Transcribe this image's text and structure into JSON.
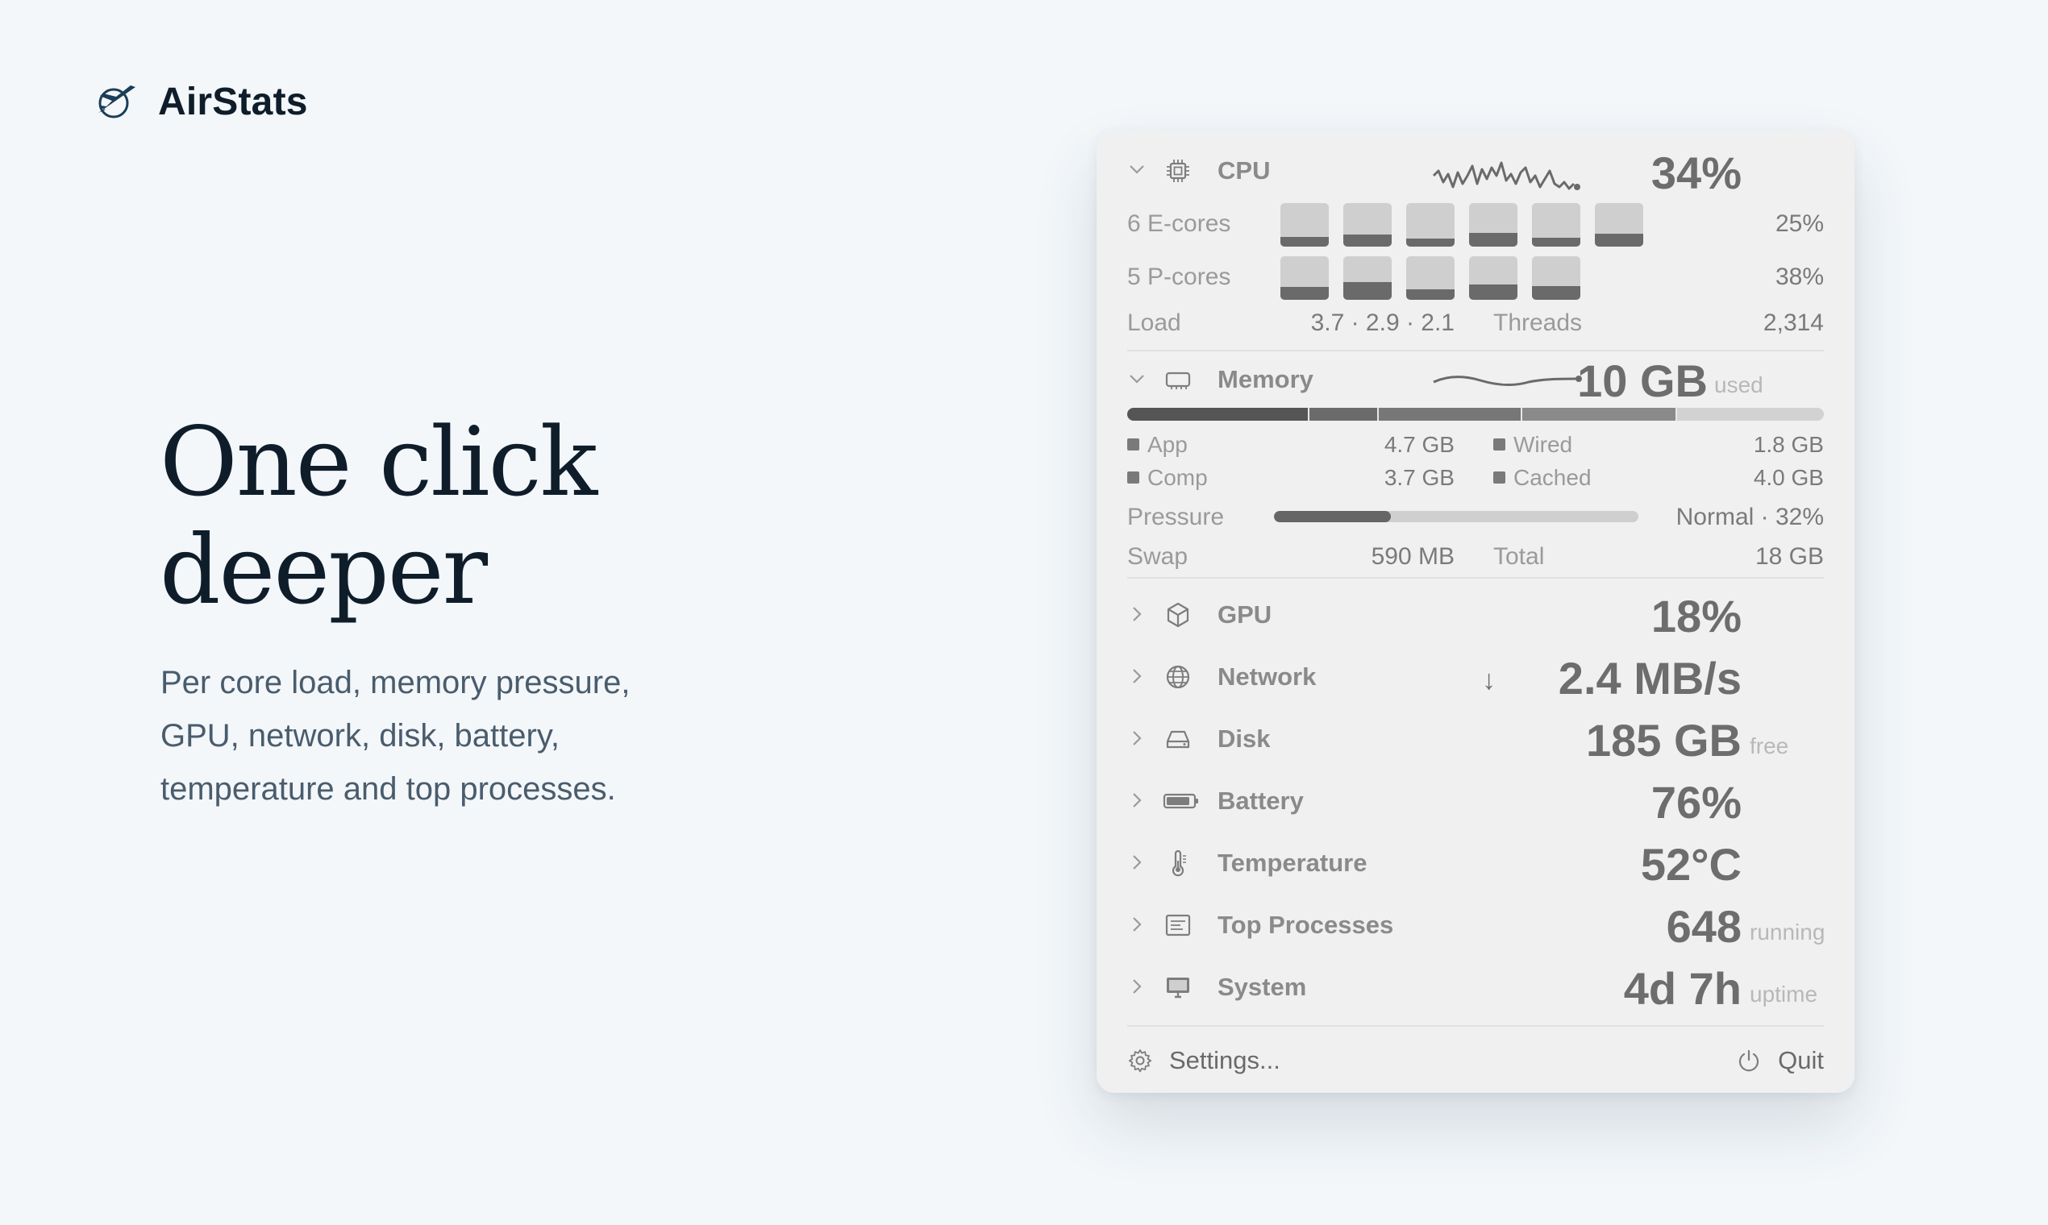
{
  "brand": {
    "name": "AirStats"
  },
  "hero": {
    "title_line1": "One click",
    "title_line2": "deeper",
    "subtitle_line1": "Per core load, memory pressure,",
    "subtitle_line2": "GPU, network, disk, battery,",
    "subtitle_line3": "temperature and top processes."
  },
  "cpu": {
    "label": "CPU",
    "value": "34%",
    "ecores_label": "6 E-cores",
    "ecores_value": "25%",
    "ecores_loads": [
      0.22,
      0.28,
      0.18,
      0.32,
      0.2,
      0.3
    ],
    "pcores_label": "5 P-cores",
    "pcores_value": "38%",
    "pcores_loads": [
      0.3,
      0.4,
      0.24,
      0.35,
      0.32
    ],
    "load_label": "Load",
    "load_value": "3.7 · 2.9 · 2.1",
    "threads_label": "Threads",
    "threads_value": "2,314"
  },
  "memory": {
    "label": "Memory",
    "value": "10 GB",
    "unit": "used",
    "segments": [
      {
        "name": "App",
        "fraction": 0.261
      },
      {
        "name": "Wired",
        "fraction": 0.1
      },
      {
        "name": "Comp",
        "fraction": 0.206
      },
      {
        "name": "Cached",
        "fraction": 0.222
      }
    ],
    "app_label": "App",
    "app_value": "4.7 GB",
    "wired_label": "Wired",
    "wired_value": "1.8 GB",
    "comp_label": "Comp",
    "comp_value": "3.7 GB",
    "cached_label": "Cached",
    "cached_value": "4.0 GB",
    "pressure_label": "Pressure",
    "pressure_value": "Normal · 32%",
    "pressure_fraction": 0.32,
    "swap_label": "Swap",
    "swap_value": "590 MB",
    "total_label": "Total",
    "total_value": "18 GB"
  },
  "rows": [
    {
      "label": "GPU",
      "value": "18%",
      "unit": "",
      "prefix": ""
    },
    {
      "label": "Network",
      "value": "2.4 MB/s",
      "unit": "",
      "prefix": "↓"
    },
    {
      "label": "Disk",
      "value": "185 GB",
      "unit": "free",
      "prefix": ""
    },
    {
      "label": "Battery",
      "value": "76%",
      "unit": "",
      "prefix": ""
    },
    {
      "label": "Temperature",
      "value": "52°C",
      "unit": "",
      "prefix": ""
    },
    {
      "label": "Top Processes",
      "value": "648",
      "unit": "running",
      "prefix": ""
    },
    {
      "label": "System",
      "value": "4d 7h",
      "unit": "uptime",
      "prefix": ""
    }
  ],
  "footer": {
    "settings_label": "Settings...",
    "quit_label": "Quit"
  },
  "icons": {
    "brand": "plane-logo-icon",
    "cpu": "chip-icon",
    "memory": "memory-icon",
    "gpu": "cube-icon",
    "network": "globe-icon",
    "disk": "drive-icon",
    "battery": "battery-icon",
    "temperature": "thermometer-icon",
    "processes": "list-icon",
    "system": "monitor-icon",
    "settings": "gear-icon",
    "quit": "power-icon"
  }
}
